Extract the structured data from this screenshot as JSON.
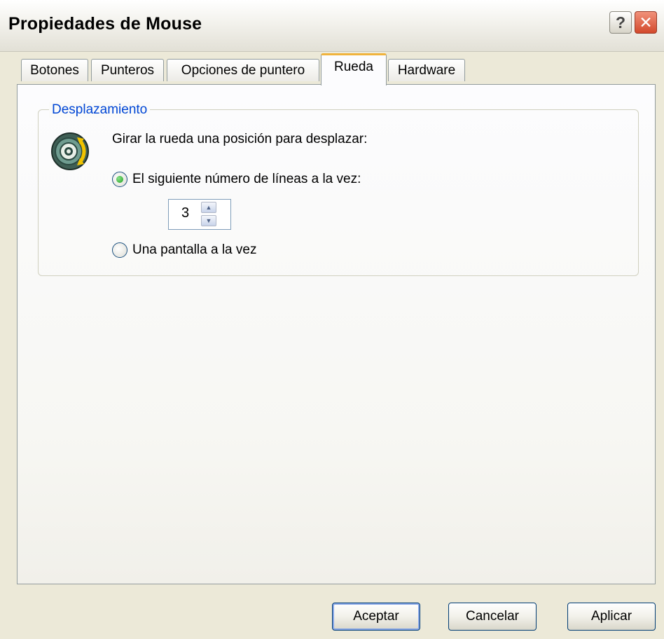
{
  "window": {
    "title": "Propiedades de Mouse",
    "help_label": "?",
    "close_label": "✕"
  },
  "tabs": [
    {
      "label": "Botones",
      "active": false
    },
    {
      "label": "Punteros",
      "active": false
    },
    {
      "label": "Opciones de puntero",
      "active": false
    },
    {
      "label": "Rueda",
      "active": true
    },
    {
      "label": "Hardware",
      "active": false
    }
  ],
  "scroll_group": {
    "title": "Desplazamiento",
    "icon": "mouse-wheel-icon",
    "instruction": "Girar la rueda una posición para desplazar:",
    "option_lines": {
      "label": "El siguiente número de líneas a la vez:",
      "selected": true
    },
    "lines_value": "3",
    "option_screen": {
      "label": "Una pantalla a la vez",
      "selected": false
    }
  },
  "buttons": {
    "ok": "Aceptar",
    "cancel": "Cancelar",
    "apply": "Aplicar"
  },
  "colors": {
    "group_title": "#0046d5",
    "active_tab_accent": "#f0b33c",
    "close_button": "#d3492c"
  }
}
